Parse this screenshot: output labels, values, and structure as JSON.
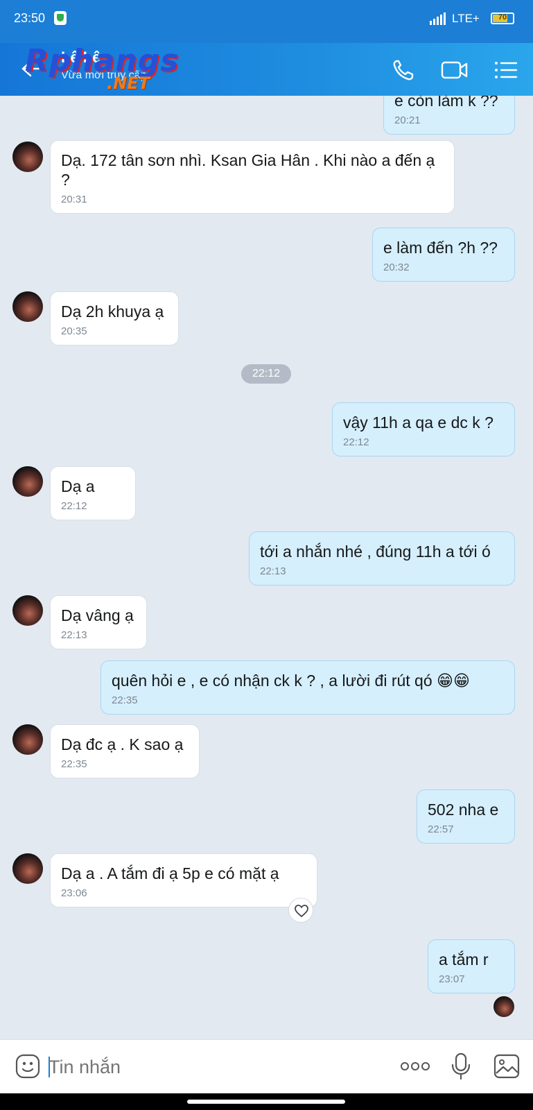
{
  "status_bar": {
    "time": "23:50",
    "network": "LTE+",
    "battery": "70"
  },
  "header": {
    "contact_name": "Lê Lê",
    "subtitle": "Vừa mới truy cập",
    "watermark_text_1": "Rphangs",
    "watermark_text_2": ".NET",
    "icons": [
      "back-arrow-icon",
      "phone-icon",
      "video-call-icon",
      "menu-list-icon"
    ]
  },
  "messages": [
    {
      "side": "out",
      "text": "e còn làm k ??",
      "time": "20:21"
    },
    {
      "side": "in",
      "text": "Dạ. 172 tân sơn nhì. Ksan Gia Hân . Khi nào a đến ạ ?",
      "time": "20:31"
    },
    {
      "side": "out",
      "text": "e làm đến ?h ??",
      "time": "20:32"
    },
    {
      "side": "in",
      "text": "Dạ 2h khuya ạ",
      "time": "20:35"
    },
    {
      "side": "divider",
      "text": "22:12"
    },
    {
      "side": "out",
      "text": "vậy 11h a qa e dc k ?",
      "time": "22:12"
    },
    {
      "side": "in",
      "text": "Dạ a",
      "time": "22:12"
    },
    {
      "side": "out",
      "text": "tới a nhắn nhé , đúng 11h a tới ó",
      "time": "22:13"
    },
    {
      "side": "in",
      "text": "Dạ vâng ạ",
      "time": "22:13"
    },
    {
      "side": "out",
      "text": "quên hỏi e , e có nhận ck k ? , a lười đi rút qó 😁😁",
      "time": "22:35"
    },
    {
      "side": "in",
      "text": "Dạ đc ạ . K sao ạ",
      "time": "22:35"
    },
    {
      "side": "out",
      "text": "502 nha e",
      "time": "22:57"
    },
    {
      "side": "in",
      "text": "Dạ a . A tắm đi ạ   5p e có mặt ạ",
      "time": "23:06"
    },
    {
      "side": "out",
      "text": "a tắm r",
      "time": "23:07"
    }
  ],
  "composer": {
    "placeholder": "Tin nhắn"
  },
  "colors": {
    "header": "#1d7ed6",
    "outgoing_bubble": "#d5effd",
    "incoming_bubble": "#ffffff",
    "chat_background": "#e2e9f1"
  }
}
